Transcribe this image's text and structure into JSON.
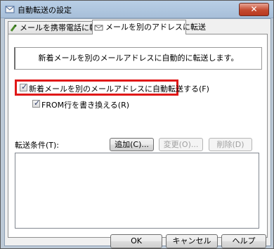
{
  "window": {
    "title": "自動転送の設定",
    "close_label": "✕"
  },
  "tabs": [
    {
      "label": "メールを携帯電話に転送",
      "active": false
    },
    {
      "label": "メールを別のアドレスに転送",
      "active": true
    }
  ],
  "panel": {
    "description": "新着メールを別のメールアドレスに自動的に転送します。",
    "auto_forward": {
      "label": "新着メールを別のメールアドレスに自動転送する(F)",
      "checked": true
    },
    "rewrite_from": {
      "label": "FROM行を書き換える(R)",
      "checked": true
    },
    "conditions_label": "転送条件(T):",
    "buttons": {
      "add": "追加(C)...",
      "edit": "変更(O)...",
      "delete": "削除(D)"
    }
  },
  "footer": {
    "ok": "OK",
    "cancel": "キャンセル",
    "help": "ヘルプ"
  },
  "colors": {
    "highlight": "#e01818",
    "accent": "#a7bfd9"
  }
}
